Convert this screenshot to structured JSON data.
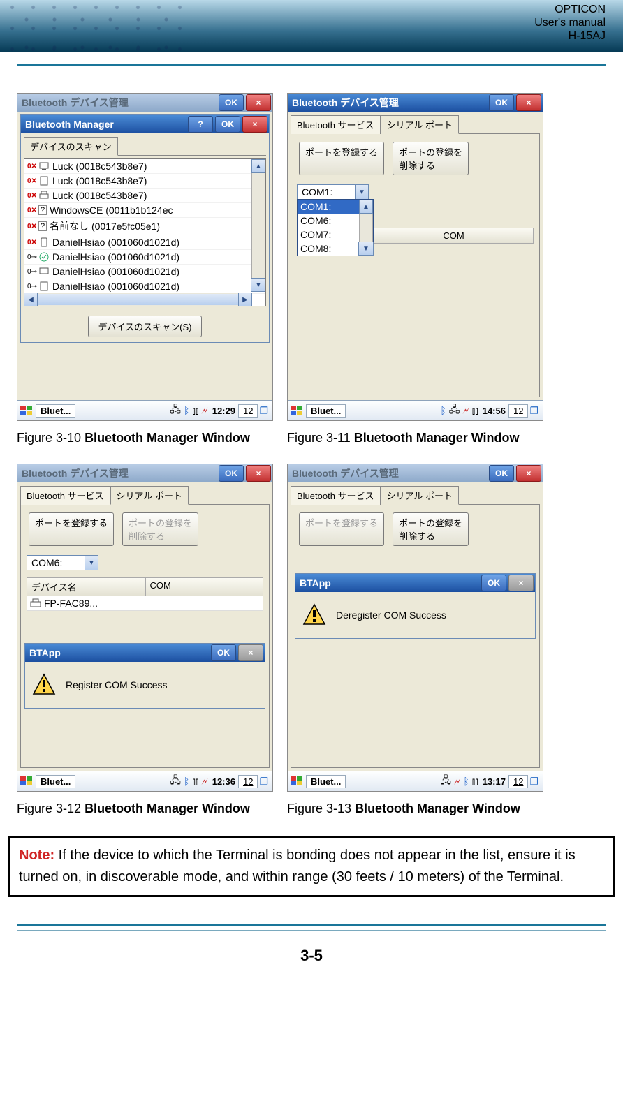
{
  "header": {
    "brand": "OPTICON",
    "line2": "User's manual",
    "model": "H-15AJ"
  },
  "page_number": "3-5",
  "note": {
    "label": "Note:",
    "body": " If the device to which the Terminal is bonding does not appear in the list, ensure it is turned on, in discoverable mode, and within range (30 feets / 10 meters) of the Terminal."
  },
  "captions": {
    "f10": {
      "prefix": "Figure 3-10 ",
      "bold": "Bluetooth Manager Window"
    },
    "f11": {
      "prefix": "Figure 3-11 ",
      "bold": "Bluetooth Manager Window"
    },
    "f12": {
      "prefix": "Figure 3-12 ",
      "bold": "Bluetooth Manager Window"
    },
    "f13": {
      "prefix": "Figure 3-13 ",
      "bold": "Bluetooth Manager Window"
    }
  },
  "common": {
    "outer_title": "Bluetooth デバイス管理",
    "ok": "OK",
    "close": "×",
    "help": "?"
  },
  "fig10": {
    "inner_title": "Bluetooth Manager",
    "tab": "デバイスのスキャン",
    "scan_btn": "デバイスのスキャン(S)",
    "devices": [
      "Luck (0018c543b8e7)",
      "Luck (0018c543b8e7)",
      "Luck (0018c543b8e7)",
      "WindowsCE (0011b1b124ec",
      "名前なし (0017e5fc05e1)",
      "DanielHsiao (001060d1021d)",
      "DanielHsiao (001060d1021d)",
      "DanielHsiao (001060d1021d)",
      "DanielHsiao (001060d1021d)"
    ],
    "task": "Bluet...",
    "clock": "12:29",
    "sip": "12"
  },
  "fig11": {
    "tab1": "Bluetooth サービス",
    "tab2": "シリアル ポート",
    "btn_reg": "ポートを登録する",
    "btn_unreg": "ポートの登録を\n削除する",
    "combo_value": "COM1:",
    "drop": [
      "COM1:",
      "COM6:",
      "COM7:",
      "COM8:"
    ],
    "th_com": "COM",
    "task": "Bluet...",
    "clock": "14:56",
    "sip": "12"
  },
  "fig12": {
    "tab1": "Bluetooth サービス",
    "tab2": "シリアル ポート",
    "btn_reg": "ポートを登録する",
    "btn_unreg": "ポートの登録を\n削除する",
    "combo_value": "COM6:",
    "th_dev": "デバイス名",
    "th_com": "COM",
    "row_device": "FP-FAC89...",
    "msg_title": "BTApp",
    "msg_body": "Register COM Success",
    "task": "Bluet...",
    "clock": "12:36",
    "sip": "12"
  },
  "fig13": {
    "tab1": "Bluetooth サービス",
    "tab2": "シリアル ポート",
    "btn_reg": "ポートを登録する",
    "btn_unreg": "ポートの登録を\n削除する",
    "msg_title": "BTApp",
    "msg_body": "Deregister COM Success",
    "task": "Bluet...",
    "clock": "13:17",
    "sip": "12"
  }
}
